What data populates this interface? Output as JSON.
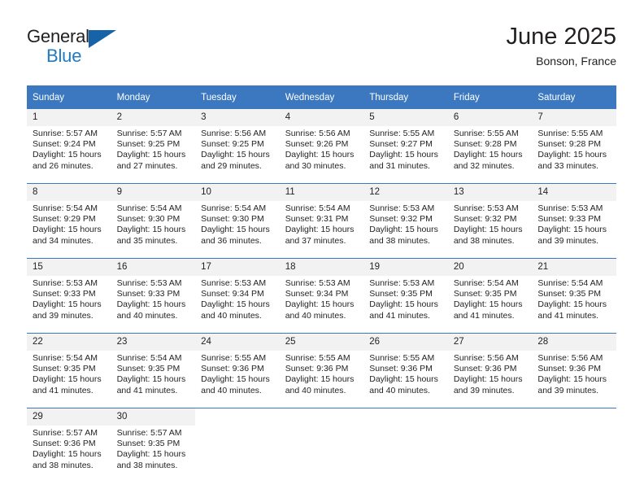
{
  "logo": {
    "word_general": "General",
    "word_blue": "Blue",
    "triangle_color": "#1763a8",
    "blue_color": "#1f7bc4"
  },
  "header": {
    "title": "June 2025",
    "subtitle": "Bonson, France",
    "accent_color": "#3b78bf",
    "daynum_bg": "#f2f2f2"
  },
  "weekday_headers": [
    "Sunday",
    "Monday",
    "Tuesday",
    "Wednesday",
    "Thursday",
    "Friday",
    "Saturday"
  ],
  "weeks": [
    {
      "days": [
        {
          "num": "1",
          "sunrise": "Sunrise: 5:57 AM",
          "sunset": "Sunset: 9:24 PM",
          "daylight1": "Daylight: 15 hours",
          "daylight2": "and 26 minutes."
        },
        {
          "num": "2",
          "sunrise": "Sunrise: 5:57 AM",
          "sunset": "Sunset: 9:25 PM",
          "daylight1": "Daylight: 15 hours",
          "daylight2": "and 27 minutes."
        },
        {
          "num": "3",
          "sunrise": "Sunrise: 5:56 AM",
          "sunset": "Sunset: 9:25 PM",
          "daylight1": "Daylight: 15 hours",
          "daylight2": "and 29 minutes."
        },
        {
          "num": "4",
          "sunrise": "Sunrise: 5:56 AM",
          "sunset": "Sunset: 9:26 PM",
          "daylight1": "Daylight: 15 hours",
          "daylight2": "and 30 minutes."
        },
        {
          "num": "5",
          "sunrise": "Sunrise: 5:55 AM",
          "sunset": "Sunset: 9:27 PM",
          "daylight1": "Daylight: 15 hours",
          "daylight2": "and 31 minutes."
        },
        {
          "num": "6",
          "sunrise": "Sunrise: 5:55 AM",
          "sunset": "Sunset: 9:28 PM",
          "daylight1": "Daylight: 15 hours",
          "daylight2": "and 32 minutes."
        },
        {
          "num": "7",
          "sunrise": "Sunrise: 5:55 AM",
          "sunset": "Sunset: 9:28 PM",
          "daylight1": "Daylight: 15 hours",
          "daylight2": "and 33 minutes."
        }
      ]
    },
    {
      "days": [
        {
          "num": "8",
          "sunrise": "Sunrise: 5:54 AM",
          "sunset": "Sunset: 9:29 PM",
          "daylight1": "Daylight: 15 hours",
          "daylight2": "and 34 minutes."
        },
        {
          "num": "9",
          "sunrise": "Sunrise: 5:54 AM",
          "sunset": "Sunset: 9:30 PM",
          "daylight1": "Daylight: 15 hours",
          "daylight2": "and 35 minutes."
        },
        {
          "num": "10",
          "sunrise": "Sunrise: 5:54 AM",
          "sunset": "Sunset: 9:30 PM",
          "daylight1": "Daylight: 15 hours",
          "daylight2": "and 36 minutes."
        },
        {
          "num": "11",
          "sunrise": "Sunrise: 5:54 AM",
          "sunset": "Sunset: 9:31 PM",
          "daylight1": "Daylight: 15 hours",
          "daylight2": "and 37 minutes."
        },
        {
          "num": "12",
          "sunrise": "Sunrise: 5:53 AM",
          "sunset": "Sunset: 9:32 PM",
          "daylight1": "Daylight: 15 hours",
          "daylight2": "and 38 minutes."
        },
        {
          "num": "13",
          "sunrise": "Sunrise: 5:53 AM",
          "sunset": "Sunset: 9:32 PM",
          "daylight1": "Daylight: 15 hours",
          "daylight2": "and 38 minutes."
        },
        {
          "num": "14",
          "sunrise": "Sunrise: 5:53 AM",
          "sunset": "Sunset: 9:33 PM",
          "daylight1": "Daylight: 15 hours",
          "daylight2": "and 39 minutes."
        }
      ]
    },
    {
      "days": [
        {
          "num": "15",
          "sunrise": "Sunrise: 5:53 AM",
          "sunset": "Sunset: 9:33 PM",
          "daylight1": "Daylight: 15 hours",
          "daylight2": "and 39 minutes."
        },
        {
          "num": "16",
          "sunrise": "Sunrise: 5:53 AM",
          "sunset": "Sunset: 9:33 PM",
          "daylight1": "Daylight: 15 hours",
          "daylight2": "and 40 minutes."
        },
        {
          "num": "17",
          "sunrise": "Sunrise: 5:53 AM",
          "sunset": "Sunset: 9:34 PM",
          "daylight1": "Daylight: 15 hours",
          "daylight2": "and 40 minutes."
        },
        {
          "num": "18",
          "sunrise": "Sunrise: 5:53 AM",
          "sunset": "Sunset: 9:34 PM",
          "daylight1": "Daylight: 15 hours",
          "daylight2": "and 40 minutes."
        },
        {
          "num": "19",
          "sunrise": "Sunrise: 5:53 AM",
          "sunset": "Sunset: 9:35 PM",
          "daylight1": "Daylight: 15 hours",
          "daylight2": "and 41 minutes."
        },
        {
          "num": "20",
          "sunrise": "Sunrise: 5:54 AM",
          "sunset": "Sunset: 9:35 PM",
          "daylight1": "Daylight: 15 hours",
          "daylight2": "and 41 minutes."
        },
        {
          "num": "21",
          "sunrise": "Sunrise: 5:54 AM",
          "sunset": "Sunset: 9:35 PM",
          "daylight1": "Daylight: 15 hours",
          "daylight2": "and 41 minutes."
        }
      ]
    },
    {
      "days": [
        {
          "num": "22",
          "sunrise": "Sunrise: 5:54 AM",
          "sunset": "Sunset: 9:35 PM",
          "daylight1": "Daylight: 15 hours",
          "daylight2": "and 41 minutes."
        },
        {
          "num": "23",
          "sunrise": "Sunrise: 5:54 AM",
          "sunset": "Sunset: 9:35 PM",
          "daylight1": "Daylight: 15 hours",
          "daylight2": "and 41 minutes."
        },
        {
          "num": "24",
          "sunrise": "Sunrise: 5:55 AM",
          "sunset": "Sunset: 9:36 PM",
          "daylight1": "Daylight: 15 hours",
          "daylight2": "and 40 minutes."
        },
        {
          "num": "25",
          "sunrise": "Sunrise: 5:55 AM",
          "sunset": "Sunset: 9:36 PM",
          "daylight1": "Daylight: 15 hours",
          "daylight2": "and 40 minutes."
        },
        {
          "num": "26",
          "sunrise": "Sunrise: 5:55 AM",
          "sunset": "Sunset: 9:36 PM",
          "daylight1": "Daylight: 15 hours",
          "daylight2": "and 40 minutes."
        },
        {
          "num": "27",
          "sunrise": "Sunrise: 5:56 AM",
          "sunset": "Sunset: 9:36 PM",
          "daylight1": "Daylight: 15 hours",
          "daylight2": "and 39 minutes."
        },
        {
          "num": "28",
          "sunrise": "Sunrise: 5:56 AM",
          "sunset": "Sunset: 9:36 PM",
          "daylight1": "Daylight: 15 hours",
          "daylight2": "and 39 minutes."
        }
      ]
    },
    {
      "days": [
        {
          "num": "29",
          "sunrise": "Sunrise: 5:57 AM",
          "sunset": "Sunset: 9:36 PM",
          "daylight1": "Daylight: 15 hours",
          "daylight2": "and 38 minutes."
        },
        {
          "num": "30",
          "sunrise": "Sunrise: 5:57 AM",
          "sunset": "Sunset: 9:35 PM",
          "daylight1": "Daylight: 15 hours",
          "daylight2": "and 38 minutes."
        },
        {
          "num": "",
          "sunrise": "",
          "sunset": "",
          "daylight1": "",
          "daylight2": ""
        },
        {
          "num": "",
          "sunrise": "",
          "sunset": "",
          "daylight1": "",
          "daylight2": ""
        },
        {
          "num": "",
          "sunrise": "",
          "sunset": "",
          "daylight1": "",
          "daylight2": ""
        },
        {
          "num": "",
          "sunrise": "",
          "sunset": "",
          "daylight1": "",
          "daylight2": ""
        },
        {
          "num": "",
          "sunrise": "",
          "sunset": "",
          "daylight1": "",
          "daylight2": ""
        }
      ]
    }
  ]
}
